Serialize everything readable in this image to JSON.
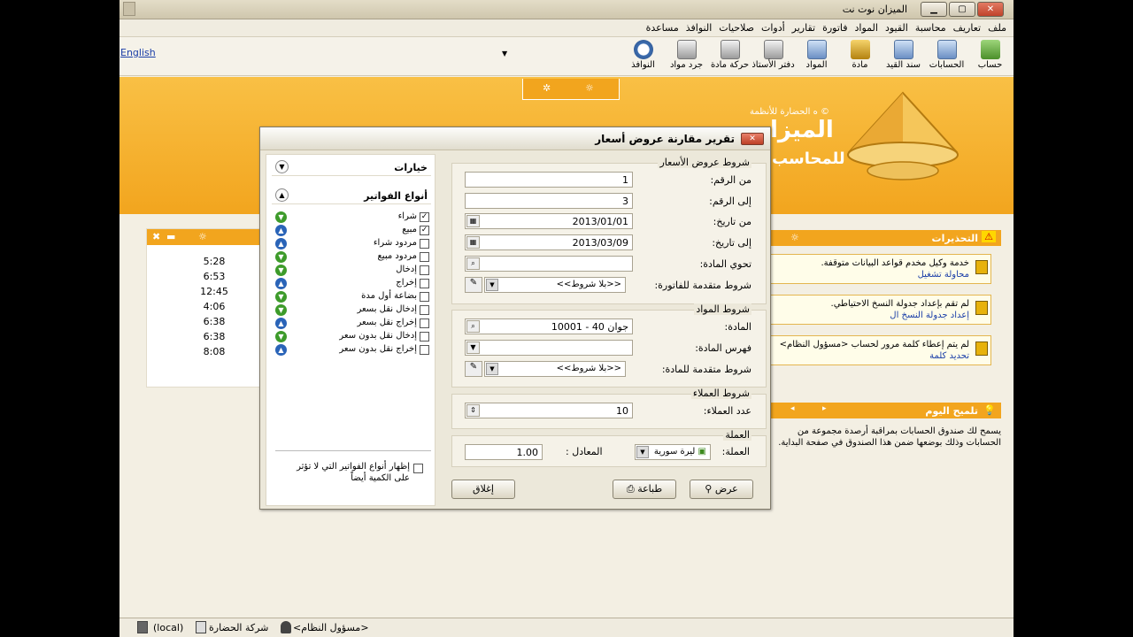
{
  "window": {
    "title": "الميزان نوت نت"
  },
  "menu": [
    "ملف",
    "تعاريف",
    "محاسبة",
    "القيود",
    "المواد",
    "فاتورة",
    "تقارير",
    "أدوات",
    "صلاحيات",
    "النوافذ",
    "مساعدة"
  ],
  "toolbar": {
    "english_link": "English",
    "items": [
      {
        "label": "حساب",
        "icon": "account-icon"
      },
      {
        "label": "الحسابات",
        "icon": "accounts-icon"
      },
      {
        "label": "سند القيد",
        "icon": "journal-voucher-icon"
      },
      {
        "label": "مادة",
        "icon": "material-icon"
      },
      {
        "label": "المواد",
        "icon": "materials-icon"
      },
      {
        "label": "دفتر الأستاذ",
        "icon": "ledger-printer-icon"
      },
      {
        "label": "حركة مادة",
        "icon": "material-movement-printer-icon"
      },
      {
        "label": "جرد مواد",
        "icon": "inventory-printer-icon"
      },
      {
        "label": "النوافذ",
        "icon": "windows-clock-icon"
      }
    ]
  },
  "banner": {
    "brand_small": "ه‌ الحضارة للأنظمة ©",
    "brand_big": "الميزا",
    "brand_sub": "للمحاسب"
  },
  "left_panel": {
    "times": [
      "5:28",
      "6:53",
      "12:45",
      "4:06",
      "6:38",
      "6:38",
      "8:08"
    ]
  },
  "warnings": {
    "title": "التحذيرات",
    "items": [
      {
        "text": "خدمة وكيل مخدم قواعد البيانات متوقفة.",
        "link": "محاولة تشغيل"
      },
      {
        "text": "لم تقم بإعداد جدولة النسخ الاحتياطي.",
        "link": "إعداد جدولة النسخ ال"
      },
      {
        "text": "لم يتم إعطاء كلمة مرور لحساب <مسؤول النظام>",
        "link": "تحديد كلمة"
      }
    ]
  },
  "tip": {
    "title": "تلميح اليوم",
    "text": "يسمح لك صندوق الحسابات بمراقبة أرصدة مجموعة من الحسابات وذلك بوضعها ضمن هذا الصندوق في صفحة البداية."
  },
  "dialog": {
    "title": "تقرير مقارنة عروض أسعار",
    "options_label": "خيارات",
    "invoice_types_label": "أنواع الفواتير",
    "invoice_types": [
      {
        "label": "شراء",
        "checked": true,
        "dir": "in"
      },
      {
        "label": "مبيع",
        "checked": true,
        "dir": "out"
      },
      {
        "label": "مردود شراء",
        "checked": false,
        "dir": "out"
      },
      {
        "label": "مردود مبيع",
        "checked": false,
        "dir": "in"
      },
      {
        "label": "إدخال",
        "checked": false,
        "dir": "in"
      },
      {
        "label": "إخراج",
        "checked": false,
        "dir": "out"
      },
      {
        "label": "بضاعة أول مدة",
        "checked": false,
        "dir": "in"
      },
      {
        "label": "إدخال نقل بسعر",
        "checked": false,
        "dir": "in"
      },
      {
        "label": "إخراج نقل بسعر",
        "checked": false,
        "dir": "out"
      },
      {
        "label": "إدخال نقل بدون سعر",
        "checked": false,
        "dir": "in"
      },
      {
        "label": "إخراج نقل بدون سعر",
        "checked": false,
        "dir": "out"
      }
    ],
    "show_all_label": "إظهار أنواع الفواتير التي لا تؤثر على الكمية أيضاً",
    "quotes_group": {
      "title": "شروط عروض الأسعار",
      "from_number_label": "من الرقم:",
      "from_number": "1",
      "to_number_label": "إلى الرقم:",
      "to_number": "3",
      "from_date_label": "من تاريخ:",
      "from_date": "2013/01/01",
      "to_date_label": "إلى تاريخ:",
      "to_date": "2013/03/09",
      "contains_material_label": "تحوي المادة:",
      "contains_material": "",
      "advanced_label": "شروط متقدمة للفاتورة:",
      "advanced_value": "<<بلا شروط>>"
    },
    "materials_group": {
      "title": "شروط المواد",
      "material_label": "المادة:",
      "material_value": "10001 - جوان  40",
      "index_label": "فهرس المادة:",
      "index_value": "",
      "advanced_label": "شروط متقدمة للمادة:",
      "advanced_value": "<<بلا شروط>>"
    },
    "customers_group": {
      "title": "شروط العملاء",
      "count_label": "عدد العملاء:",
      "count_value": "10"
    },
    "currency_group": {
      "title": "العملة",
      "currency_label": "العملة:",
      "currency_value": "ليرة سورية",
      "rate_label": "المعادل :",
      "rate_value": "1.00"
    },
    "buttons": {
      "view": "عرض",
      "print": "طباعة",
      "close": "إغلاق"
    }
  },
  "statusbar": {
    "user": "<مسؤول النظام>",
    "company": "شركة الحضارة",
    "server": "(local)"
  }
}
